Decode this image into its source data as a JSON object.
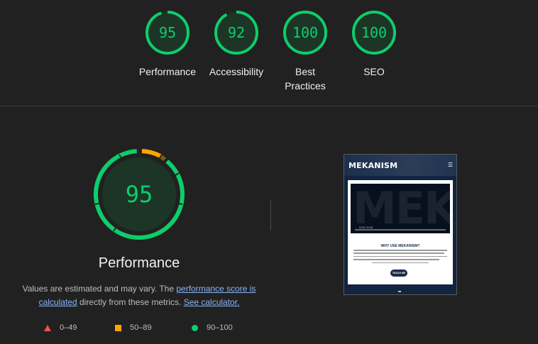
{
  "categories": [
    {
      "label": "Performance",
      "score": "95",
      "fraction": 0.95,
      "color": "#0cce6b"
    },
    {
      "label": "Accessibility",
      "score": "92",
      "fraction": 0.92,
      "color": "#0cce6b"
    },
    {
      "label": "Best Practices",
      "score": "100",
      "fraction": 1.0,
      "color": "#0cce6b"
    },
    {
      "label": "SEO",
      "score": "100",
      "fraction": 1.0,
      "color": "#0cce6b"
    }
  ],
  "performance": {
    "score": "95",
    "fraction": 0.95,
    "title": "Performance",
    "desc_prefix": "Values are estimated and may vary. The ",
    "desc_link1": "performance score is calculated",
    "desc_middle": " directly from these metrics. ",
    "desc_link2": "See calculator."
  },
  "legend": [
    {
      "range": "0–49",
      "shape": "triangle",
      "color": "#ff4e42"
    },
    {
      "range": "50–89",
      "shape": "square",
      "color": "#ffa400"
    },
    {
      "range": "90–100",
      "shape": "circle",
      "color": "#0cce6b"
    }
  ],
  "screenshot": {
    "brand": "MEKANISM",
    "menu_icon": "hamburger-icon",
    "hero_text": "MEK",
    "video_time": "0:03 / 0:18",
    "heading": "WHY USE MEKANISM?",
    "button": "TEACH ME"
  }
}
